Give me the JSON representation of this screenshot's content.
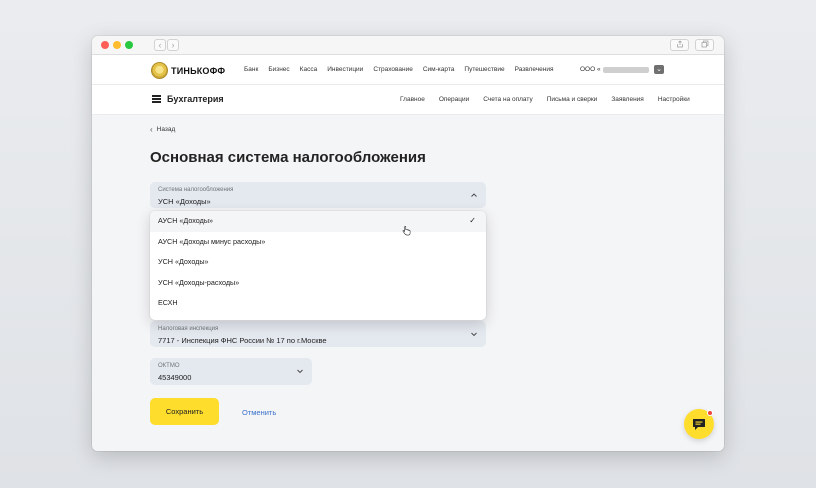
{
  "header": {
    "logo_text": "ТИНЬКОФФ",
    "nav": [
      "Банк",
      "Бизнес",
      "Касса",
      "Инвестиции",
      "Страхование",
      "Сим-карта",
      "Путешествие",
      "Развлечения"
    ],
    "company": "ООО «"
  },
  "subheader": {
    "title": "Бухгалтерия",
    "nav": [
      "Главное",
      "Операции",
      "Счета на оплату",
      "Письма и сверки",
      "Заявления",
      "Настройки"
    ]
  },
  "page": {
    "back_label": "Назад",
    "title": "Основная система налогообложения"
  },
  "tax_field": {
    "label": "Система налогообложения",
    "value": "УСН «Доходы»"
  },
  "dropdown": {
    "options": [
      "АУСН «Доходы»",
      "АУСН «Доходы минус расходы»",
      "УСН «Доходы»",
      "УСН «Доходы-расходы»",
      "ЕСХН"
    ],
    "selected_index": 0
  },
  "inspection_field": {
    "label": "Налоговая инспекция",
    "value": "7717 - Инспекция ФНС России № 17 по г.Москве"
  },
  "oktmo_field": {
    "label": "ОКТМО",
    "value": "45349000"
  },
  "actions": {
    "save_label": "Сохранить",
    "cancel_label": "Отменить"
  },
  "colors": {
    "accent": "#ffdd2d",
    "link": "#3a6fcc",
    "field_bg": "#e4e8ef",
    "notification": "#f04438"
  }
}
